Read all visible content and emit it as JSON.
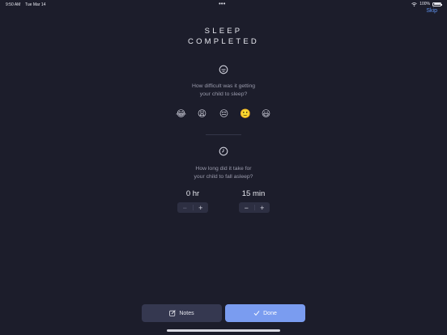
{
  "status_bar": {
    "time": "9:50 AM",
    "date": "Tue Mar 14",
    "dots": "•••",
    "battery_text": "100%",
    "battery_level": 1.0
  },
  "header": {
    "skip_label": "Skip",
    "title_line1": "SLEEP",
    "title_line2": "COMPLETED"
  },
  "difficulty": {
    "icon": "sleeping-face-icon",
    "question_line1": "How difficult was it getting",
    "question_line2": "your child to sleep?",
    "options": [
      "😂",
      "😩",
      "😔",
      "🙂",
      "😃"
    ]
  },
  "duration": {
    "icon": "clock-icon",
    "question_line1": "How long did it take for",
    "question_line2": "your child to fall asleep?",
    "hours_label": "0 hr",
    "minutes_label": "15 min",
    "minus": "−",
    "plus": "+"
  },
  "actions": {
    "notes_label": "Notes",
    "done_label": "Done"
  },
  "colors": {
    "background": "#1c1d2b",
    "accent": "#7a9cf0",
    "link": "#5f93f0"
  }
}
